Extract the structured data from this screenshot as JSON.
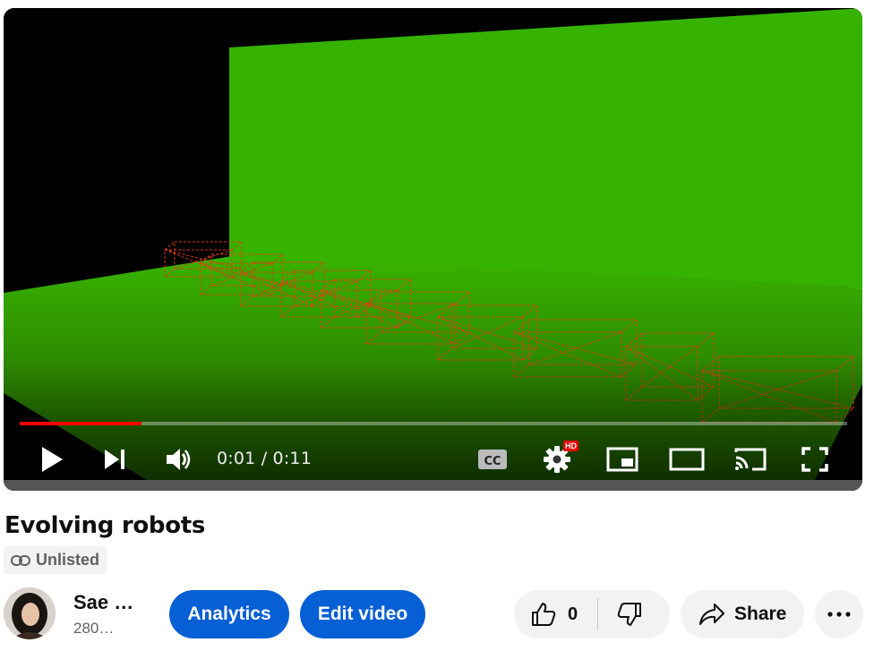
{
  "player": {
    "current_time": "0:01",
    "duration": "0:11",
    "time_display": "0:01 / 0:11",
    "progress_fraction": 0.147,
    "quality_badge": "HD",
    "colors": {
      "progress": "#ff0000",
      "ground": "#36b200",
      "robot_wire": "#e03c14"
    }
  },
  "video": {
    "title": "Evolving robots",
    "visibility": "Unlisted"
  },
  "channel": {
    "name": "Sae …",
    "subscribers": "280…"
  },
  "actions": {
    "analytics_label": "Analytics",
    "edit_label": "Edit video",
    "like_count": "0",
    "share_label": "Share",
    "accent": "#065fd4"
  },
  "icons": [
    "play-icon",
    "next-icon",
    "volume-icon",
    "captions-icon",
    "settings-icon",
    "miniplayer-icon",
    "theater-icon",
    "cast-icon",
    "fullscreen-icon",
    "link-icon",
    "thumbs-up-icon",
    "thumbs-down-icon",
    "share-icon",
    "more-icon"
  ]
}
